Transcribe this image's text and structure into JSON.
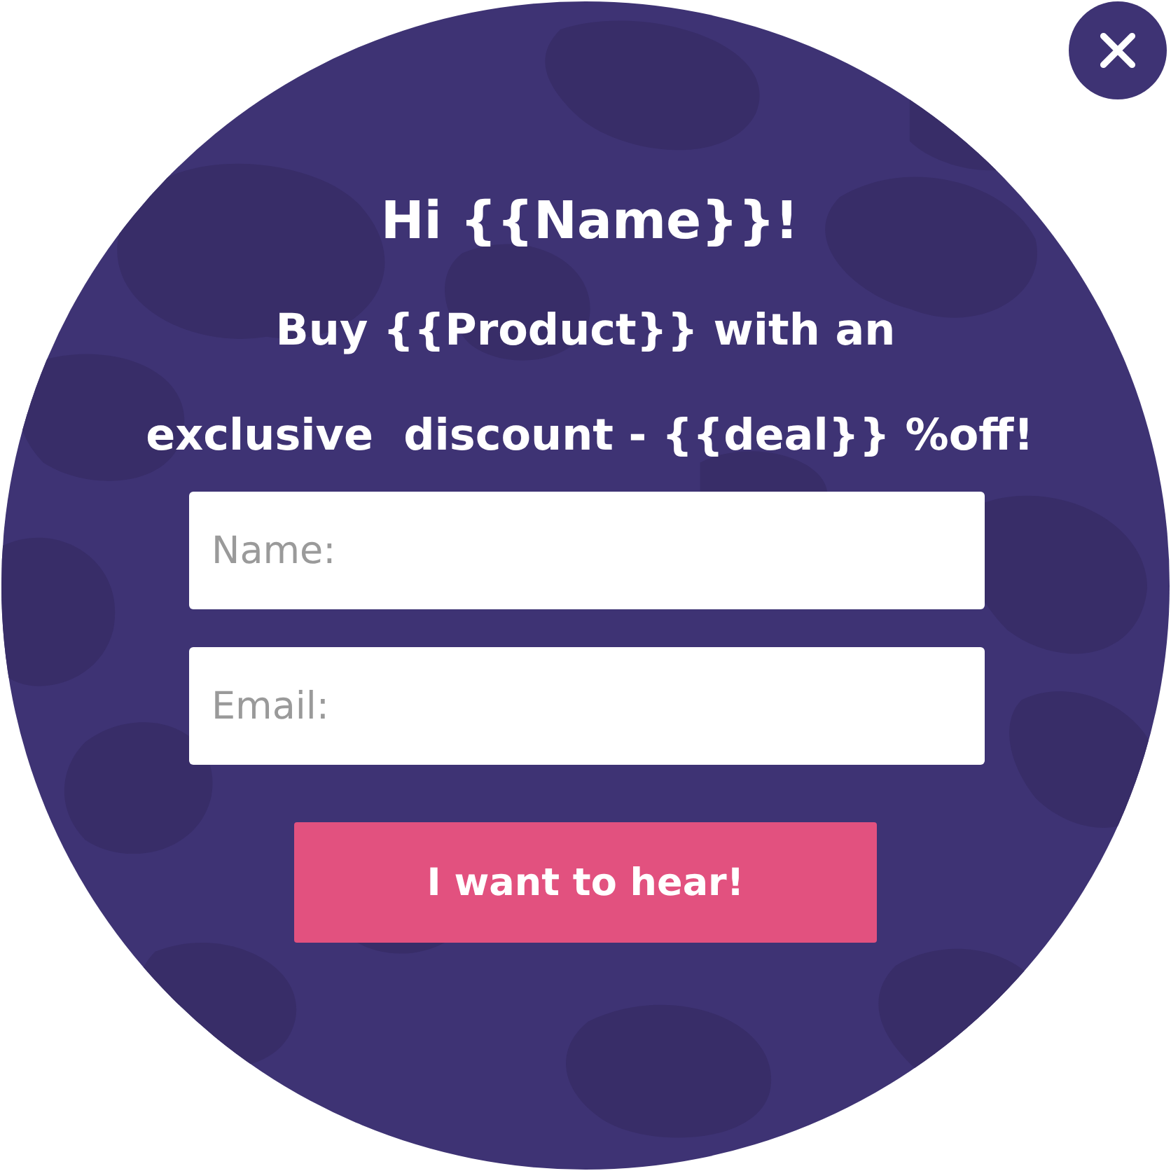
{
  "heading": "Hi {{Name}}!",
  "lines": [
    "Buy {{Product}} with an",
    "exclusive  discount - {{deal}} %off!"
  ],
  "fields": [
    {
      "placeholder": "Name:"
    },
    {
      "placeholder": "Email:"
    }
  ],
  "submit_button": "I want to hear!"
}
